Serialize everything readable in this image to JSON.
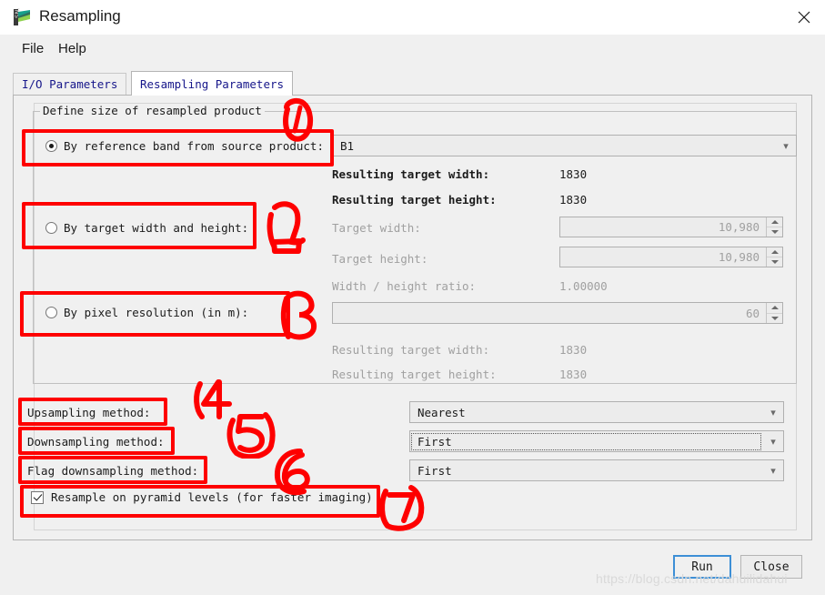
{
  "window": {
    "title": "Resampling",
    "app_icon": "snap-app-icon",
    "close_icon": "close-icon"
  },
  "menu": {
    "items": [
      {
        "label": "File",
        "name": "menu-file"
      },
      {
        "label": "Help",
        "name": "menu-help"
      }
    ]
  },
  "tabs": [
    {
      "label": "I/O Parameters",
      "active": false
    },
    {
      "label": "Resampling Parameters",
      "active": true
    }
  ],
  "group": {
    "title": "Define size of resampled product"
  },
  "options": {
    "by_reference_band": {
      "label": "By reference band from source product:",
      "selected": true
    },
    "by_target_size": {
      "label": "By target width and height:",
      "selected": false
    },
    "by_pixel_resolution": {
      "label": "By pixel resolution (in m):",
      "selected": false
    }
  },
  "reference_band": {
    "value": "B1",
    "chevron": "chevron-down-icon"
  },
  "reference_results": [
    {
      "label": "Resulting target width:",
      "value": "1830"
    },
    {
      "label": "Resulting target height:",
      "value": "1830"
    }
  ],
  "target_fields": [
    {
      "label": "Target width:",
      "value": "10,980"
    },
    {
      "label": "Target height:",
      "value": "10,980"
    }
  ],
  "ratio": {
    "label": "Width / height ratio:",
    "value": "1.00000"
  },
  "pixel_resolution": {
    "value": "60"
  },
  "pixel_results": [
    {
      "label": "Resulting target width:",
      "value": "1830"
    },
    {
      "label": "Resulting target height:",
      "value": "1830"
    }
  ],
  "methods": [
    {
      "label": "Upsampling method:",
      "value": "Nearest",
      "focused": false
    },
    {
      "label": "Downsampling method:",
      "value": "First",
      "focused": true
    },
    {
      "label": "Flag downsampling method:",
      "value": "First",
      "focused": false
    }
  ],
  "pyramid": {
    "label": "Resample on pyramid levels (for faster imaging)",
    "checked": true
  },
  "buttons": {
    "run": "Run",
    "close": "Close"
  },
  "watermark": "https://blog.csdn.net/dahuilidahui",
  "annotations": {
    "color": "#fe0000",
    "numbers": [
      "1",
      "2",
      "3",
      "4",
      "5",
      "6",
      "7"
    ]
  }
}
